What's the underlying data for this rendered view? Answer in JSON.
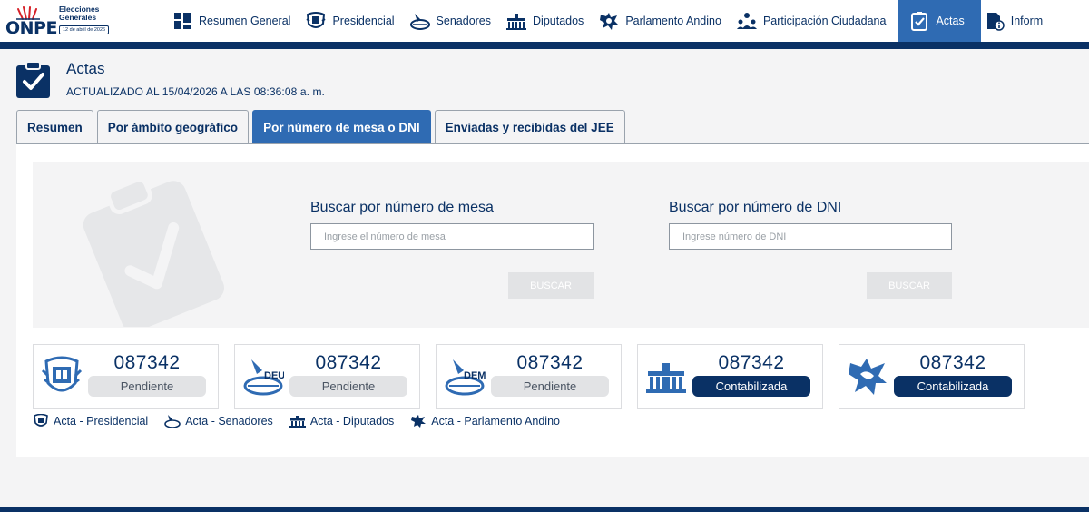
{
  "logo": {
    "brand": "ONPE",
    "event_line1": "Elecciones",
    "event_line2": "Generales",
    "event_date": "12 de abril de 2026"
  },
  "nav": {
    "items": [
      {
        "label": "Resumen General",
        "icon": "summary-grid-icon"
      },
      {
        "label": "Presidencial",
        "icon": "presidential-seal-icon"
      },
      {
        "label": "Senadores",
        "icon": "senate-icon"
      },
      {
        "label": "Diputados",
        "icon": "congress-building-icon"
      },
      {
        "label": "Parlamento Andino",
        "icon": "andean-parliament-icon"
      },
      {
        "label": "Participación Ciudadana",
        "icon": "citizens-icon"
      },
      {
        "label": "Actas",
        "icon": "clipboard-check-icon",
        "active": true
      },
      {
        "label": "Inform",
        "icon": "info-document-icon"
      }
    ]
  },
  "header": {
    "title": "Actas",
    "updated": "ACTUALIZADO AL 15/04/2026 A LAS 08:36:08 a. m."
  },
  "tabs": [
    {
      "label": "Resumen"
    },
    {
      "label": "Por ámbito geográfico"
    },
    {
      "label": "Por número de mesa o DNI",
      "active": true
    },
    {
      "label": "Enviadas y recibidas del JEE"
    }
  ],
  "search": {
    "mesa": {
      "label": "Buscar por número de mesa",
      "placeholder": "Ingrese el número de mesa",
      "value": "",
      "button": "BUSCAR"
    },
    "dni": {
      "label": "Buscar por número de DNI",
      "placeholder": "Ingrese número de DNI",
      "value": "",
      "button": "BUSCAR"
    }
  },
  "cards": [
    {
      "number": "087342",
      "status": "Pendiente",
      "state": "pending",
      "icon": "presidential-seal-icon"
    },
    {
      "number": "087342",
      "status": "Pendiente",
      "state": "pending",
      "icon": "deu-ballot-icon",
      "icon_text": "DEU"
    },
    {
      "number": "087342",
      "status": "Pendiente",
      "state": "pending",
      "icon": "dem-ballot-icon",
      "icon_text": "DEM"
    },
    {
      "number": "087342",
      "status": "Contabilizada",
      "state": "done",
      "icon": "congress-building-icon"
    },
    {
      "number": "087342",
      "status": "Contabilizada",
      "state": "done",
      "icon": "andean-parliament-icon"
    }
  ],
  "legend": [
    {
      "label": "Acta - Presidencial",
      "icon": "presidential-seal-icon"
    },
    {
      "label": "Acta - Senadores",
      "icon": "senate-icon"
    },
    {
      "label": "Acta - Diputados",
      "icon": "congress-building-icon"
    },
    {
      "label": "Acta - Parlamento Andino",
      "icon": "andean-parliament-icon"
    }
  ],
  "colors": {
    "brand": "#0a3165",
    "accent": "#2f6bb3",
    "pending": "#e2e3e5",
    "done": "#0a3165"
  }
}
